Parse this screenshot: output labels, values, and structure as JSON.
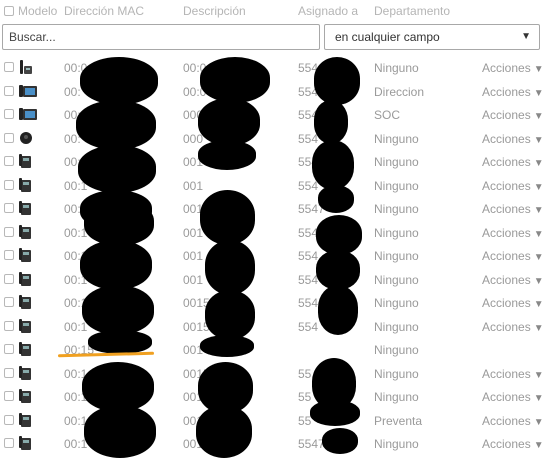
{
  "header": {
    "model": "Modelo",
    "mac": "Dirección MAC",
    "description": "Descripción",
    "assigned": "Asignado a",
    "department": "Departamento"
  },
  "filter": {
    "search_placeholder": "Buscar...",
    "field_select": "en cualquier campo"
  },
  "rows": [
    {
      "model_icon": "desk-phone-handset-icon",
      "mac": "00:0",
      "desc": "00:0",
      "asig": "554",
      "dept": "Ninguno",
      "actions": "Acciones"
    },
    {
      "model_icon": "video-phone-icon",
      "mac": "00:",
      "desc": "00:0",
      "asig": "554",
      "dept": "Direccion",
      "actions": "Acciones"
    },
    {
      "model_icon": "video-phone-icon",
      "mac": "00:",
      "desc": "000",
      "asig": "554",
      "dept": "SOC",
      "actions": "Acciones"
    },
    {
      "model_icon": "conference-phone-icon",
      "mac": "00:",
      "desc": "000",
      "asig": "554",
      "dept": "Ninguno",
      "actions": "Acciones"
    },
    {
      "model_icon": "desk-phone-icon",
      "mac": "00:1",
      "desc": "001",
      "asig": "554",
      "dept": "Ninguno",
      "actions": "Acciones"
    },
    {
      "model_icon": "desk-phone-icon",
      "mac": "00:1",
      "desc": "001",
      "asig": "554",
      "dept": "Ninguno",
      "actions": "Acciones"
    },
    {
      "model_icon": "desk-phone-icon",
      "mac": "00:1",
      "desc": "0015",
      "asig": "5547",
      "dept": "Ninguno",
      "actions": "Acciones"
    },
    {
      "model_icon": "desk-phone-icon",
      "mac": "00:1",
      "desc": "001",
      "asig": "554",
      "dept": "Ninguno",
      "actions": "Acciones"
    },
    {
      "model_icon": "desk-phone-icon",
      "mac": "00:1",
      "desc": "001",
      "asig": "554",
      "dept": "Ninguno",
      "actions": "Acciones"
    },
    {
      "model_icon": "desk-phone-icon",
      "mac": "00:1",
      "desc": "001",
      "asig": "554",
      "dept": "Ninguno",
      "actions": "Acciones"
    },
    {
      "model_icon": "desk-phone-icon",
      "mac": "00:1",
      "desc": "0015",
      "asig": "554",
      "dept": "Ninguno",
      "actions": "Acciones"
    },
    {
      "model_icon": "desk-phone-icon",
      "mac": "00:1",
      "desc": "0015",
      "asig": "554",
      "dept": "Ninguno",
      "actions": "Acciones"
    },
    {
      "model_icon": "desk-phone-icon",
      "mac": "00:15",
      "desc": "001",
      "asig": "",
      "dept": "Ninguno",
      "actions": ""
    },
    {
      "model_icon": "desk-phone-icon",
      "mac": "00:1",
      "desc": "0015",
      "asig": "55",
      "dept": "Ninguno",
      "actions": "Acciones"
    },
    {
      "model_icon": "desk-phone-icon",
      "mac": "00:1",
      "desc": "0015",
      "asig": "55",
      "dept": "Ninguno",
      "actions": "Acciones"
    },
    {
      "model_icon": "desk-phone-icon",
      "mac": "00:1",
      "desc": "001",
      "asig": "55",
      "dept": "Preventa",
      "actions": "Acciones"
    },
    {
      "model_icon": "desk-phone-icon",
      "mac": "00:1",
      "desc": "001",
      "asig": "5547",
      "dept": "Ninguno",
      "actions": "Acciones"
    }
  ]
}
